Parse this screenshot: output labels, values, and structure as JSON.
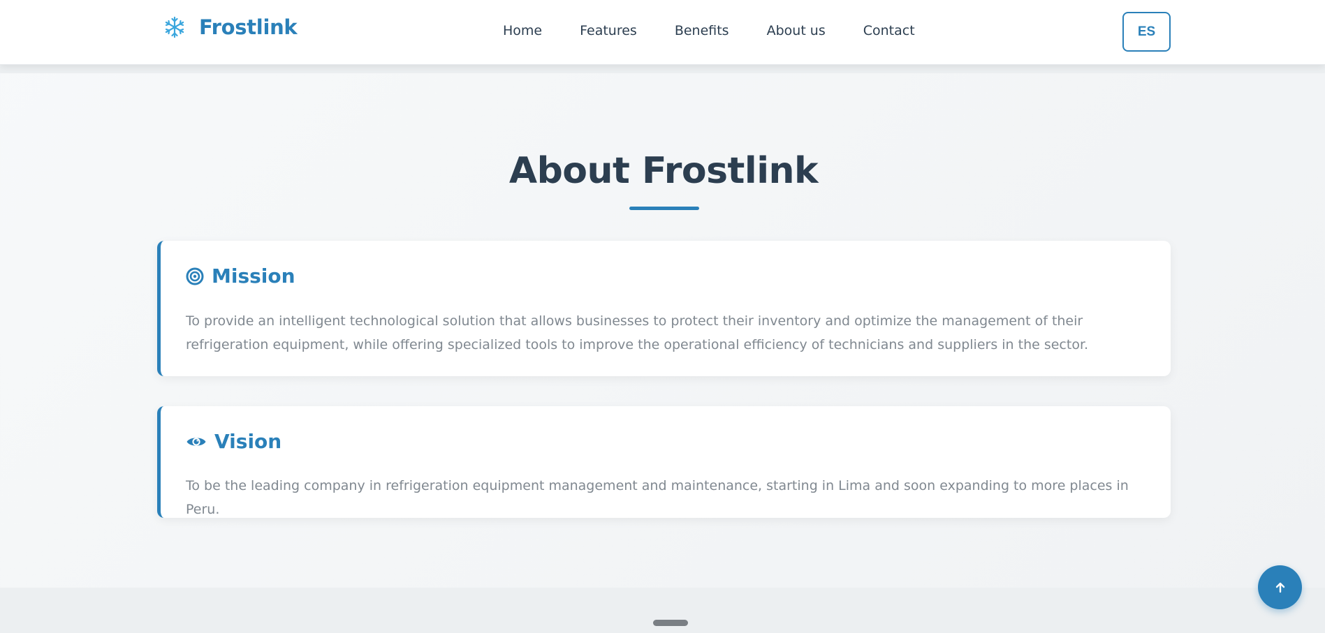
{
  "header": {
    "brand": "Frostlink",
    "logo_icon": "snowflake-icon",
    "nav": [
      {
        "label": "Home"
      },
      {
        "label": "Features"
      },
      {
        "label": "Benefits"
      },
      {
        "label": "About us"
      },
      {
        "label": "Contact"
      }
    ],
    "language_button": "ES"
  },
  "about": {
    "title": "About Frostlink",
    "mission": {
      "icon": "target-icon",
      "title": "Mission",
      "text": "To provide an intelligent technological solution that allows businesses to protect their inventory and optimize the management of their refrigeration equipment, while offering specialized tools to improve the operational efficiency of technicians and suppliers in the sector."
    },
    "vision": {
      "icon": "eye-icon",
      "title": "Vision",
      "text": "To be the leading company in refrigeration equipment management and maintenance, starting in Lima and soon expanding to more places in Peru."
    }
  },
  "back_to_top_icon": "arrow-up-icon",
  "colors": {
    "accent": "#2a80b9",
    "heading": "#2c3e50",
    "body_text": "#808890",
    "logo_icon": "#3aa6dd"
  }
}
